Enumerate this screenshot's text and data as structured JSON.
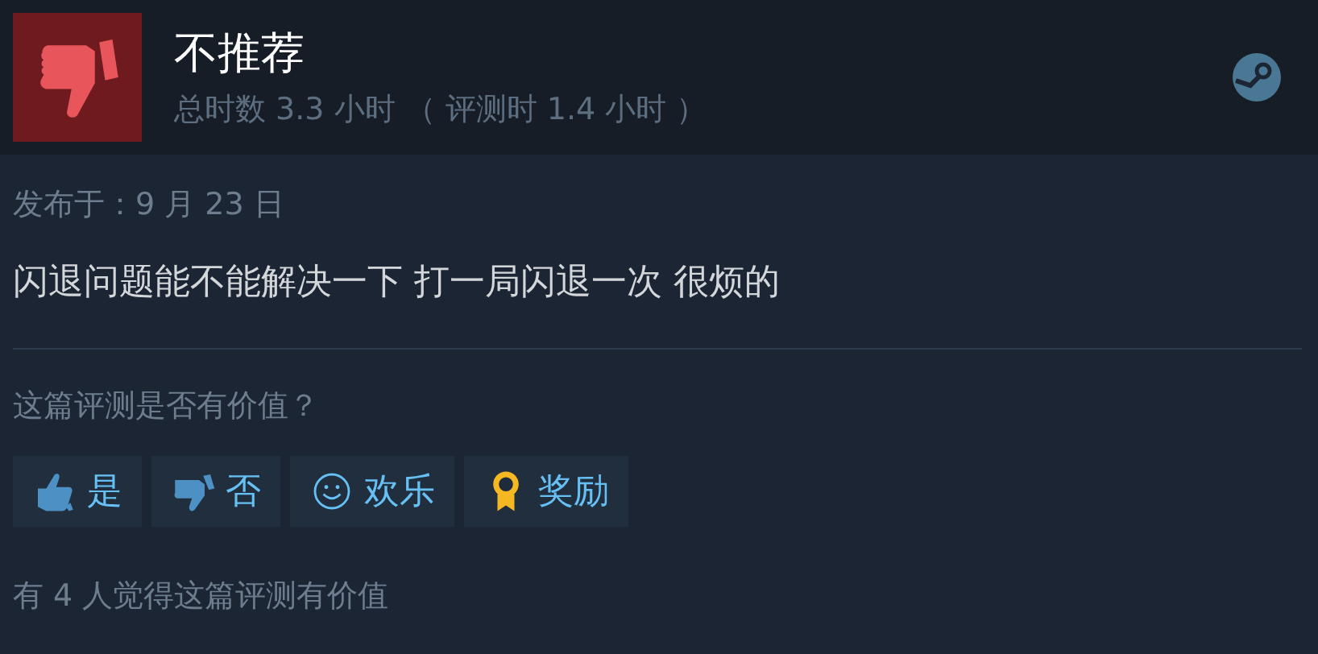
{
  "header": {
    "verdict": "不推荐",
    "recommended": false,
    "playtime": "总时数 3.3 小时 （ 评测时 1.4 小时 ）"
  },
  "review": {
    "posted": "发布于：9 月 23 日",
    "text": "闪退问题能不能解决一下 打一局闪退一次 很烦的"
  },
  "helpful": {
    "question": "这篇评测是否有价值？",
    "buttons": [
      {
        "kind": "yes",
        "label": "是"
      },
      {
        "kind": "no",
        "label": "否"
      },
      {
        "kind": "funny",
        "label": "欢乐"
      },
      {
        "kind": "award",
        "label": "奖励"
      }
    ],
    "summary": "有 4 人觉得这篇评测有价值"
  }
}
